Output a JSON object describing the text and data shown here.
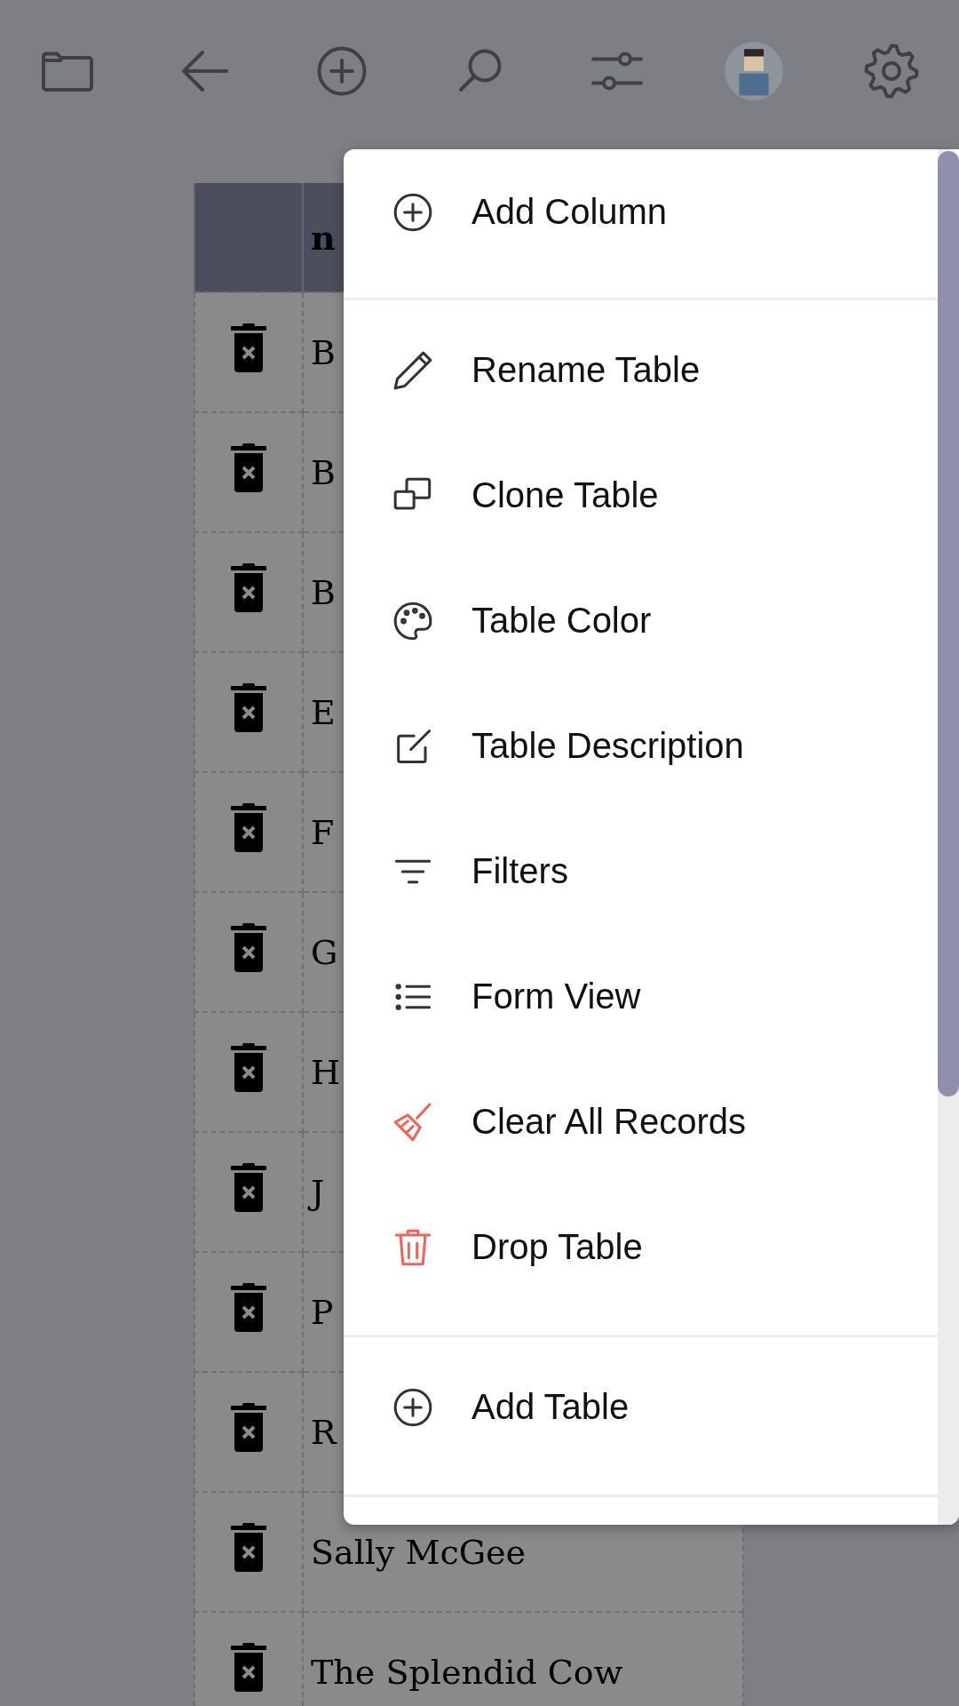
{
  "toolbar": {
    "buttons": [
      {
        "kind": "folder"
      },
      {
        "kind": "back"
      },
      {
        "kind": "add"
      },
      {
        "kind": "search"
      },
      {
        "kind": "sliders"
      },
      {
        "kind": "avatar"
      },
      {
        "kind": "settings"
      }
    ]
  },
  "table": {
    "columns": [
      "",
      "n"
    ],
    "rows": [
      {
        "cells": [
          "",
          "B"
        ]
      },
      {
        "cells": [
          "",
          "B"
        ]
      },
      {
        "cells": [
          "",
          "B"
        ]
      },
      {
        "cells": [
          "",
          "E"
        ]
      },
      {
        "cells": [
          "",
          "F"
        ]
      },
      {
        "cells": [
          "",
          "G"
        ]
      },
      {
        "cells": [
          "",
          "H"
        ]
      },
      {
        "cells": [
          "",
          "J"
        ]
      },
      {
        "cells": [
          "",
          "P"
        ]
      },
      {
        "cells": [
          "",
          "R"
        ]
      },
      {
        "cells": [
          "",
          "Sally McGee"
        ]
      },
      {
        "cells": [
          "",
          "The Splendid Cow"
        ]
      }
    ]
  },
  "menu": {
    "sections": [
      [
        {
          "label": "Add Column",
          "kind": "plus"
        }
      ],
      [
        {
          "label": "Rename Table",
          "kind": "pencil"
        },
        {
          "label": "Clone Table",
          "kind": "clone"
        },
        {
          "label": "Table Color",
          "kind": "palette"
        },
        {
          "label": "Table Description",
          "kind": "edit"
        },
        {
          "label": "Filters",
          "kind": "filter"
        },
        {
          "label": "Form View",
          "kind": "list"
        },
        {
          "label": "Clear All Records",
          "kind": "broom"
        },
        {
          "label": "Drop Table",
          "kind": "trash"
        }
      ],
      [
        {
          "label": "Add Table",
          "kind": "plus"
        }
      ]
    ]
  }
}
